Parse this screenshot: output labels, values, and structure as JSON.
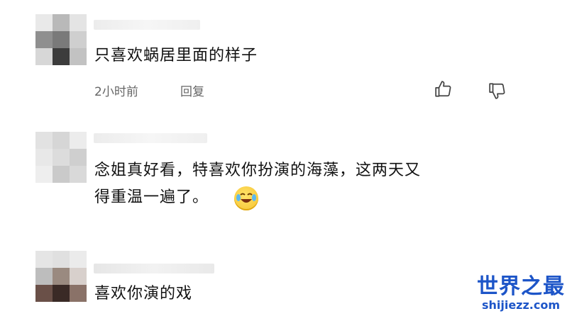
{
  "comments": [
    {
      "text": "只喜欢蜗居里面的样子",
      "time": "2小时前",
      "reply_label": "回复"
    },
    {
      "text": "念姐真好看，特喜欢你扮演的海藻，这两天又\n得重温一遍了。",
      "emoji": "laughing-crying-emoji"
    },
    {
      "text": "喜欢你演的戏"
    }
  ],
  "actions": {
    "like_icon": "thumbs-up-icon",
    "dislike_icon": "thumbs-down-icon"
  },
  "watermark": {
    "title": "世界之最",
    "url": "shijiezz.com"
  },
  "colors": {
    "text": "#111111",
    "meta": "#666666",
    "watermark": "#1d55c8"
  }
}
